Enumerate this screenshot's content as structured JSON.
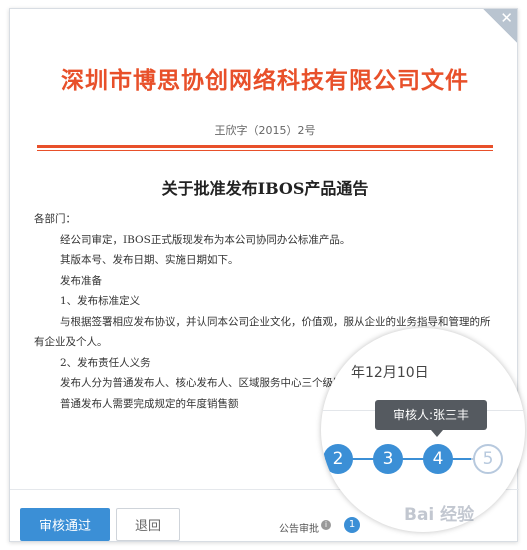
{
  "document": {
    "company": "深圳市博思协创网络科技有限公司文件",
    "doc_number": "王欣字（2015）2号",
    "subject": "关于批准发布IBOS产品通告",
    "lines": [
      "各部门：",
      "经公司审定，IBOS正式版现发布为本公司协同办公标准产品。",
      "其版本号、发布日期、实施日期如下。",
      "发布准备",
      "1、发布标准定义",
      "与根据签署相应发布协议，并认同本公司企业文化，价值观，服从企业的业务指导和管理的所有企业及个人。",
      "2、发布责任人义务",
      "发布人分为普通发布人、核心发布人、区域服务中心三个级别。",
      "普通发布人需要完成规定的年度销售额"
    ]
  },
  "footer": {
    "approve_label": "审核通过",
    "return_label": "退回",
    "approval_label": "公告审批",
    "info_glyph": "i",
    "current_step": "1"
  },
  "magnifier": {
    "date_text": "年12月10日",
    "tooltip": "审核人:张三丰",
    "steps": [
      "2",
      "3",
      "4",
      "5"
    ]
  },
  "window": {
    "close_glyph": "✕"
  },
  "watermark": "Bai 经验",
  "colors": {
    "accent": "#e8502a",
    "primary": "#3b8fd6",
    "pending": "#b7c9de"
  }
}
